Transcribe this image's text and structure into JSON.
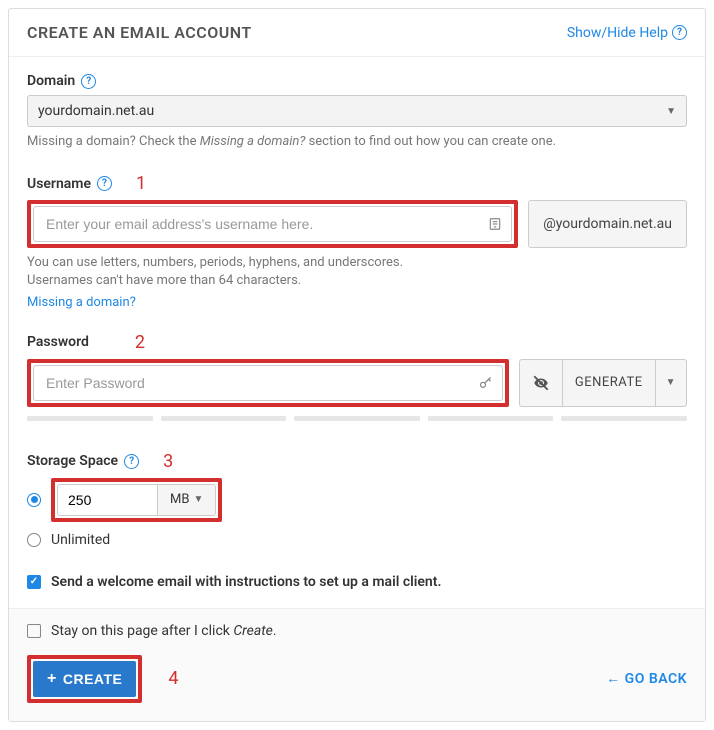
{
  "header": {
    "title": "CREATE AN EMAIL ACCOUNT",
    "help_link": "Show/Hide Help"
  },
  "domain": {
    "label": "Domain",
    "value": "yourdomain.net.au",
    "hint_pre": "Missing a domain? Check the ",
    "hint_em": "Missing a domain?",
    "hint_post": " section to find out how you can create one."
  },
  "username": {
    "label": "Username",
    "placeholder": "Enter your email address's username here.",
    "suffix": "@yourdomain.net.au",
    "hint_line1": "You can use letters, numbers, periods, hyphens, and underscores.",
    "hint_line2": "Usernames can't have more than 64 characters.",
    "missing_link": "Missing a domain?"
  },
  "password": {
    "label": "Password",
    "placeholder": "Enter Password",
    "generate": "GENERATE"
  },
  "storage": {
    "label": "Storage Space",
    "value": "250",
    "unit": "MB",
    "unlimited": "Unlimited"
  },
  "welcome": {
    "label": "Send a welcome email with instructions to set up a mail client."
  },
  "stay": {
    "label_pre": "Stay on this page after I click ",
    "label_em": "Create",
    "label_post": "."
  },
  "actions": {
    "create": "CREATE",
    "back": "GO BACK"
  },
  "annotations": {
    "n1": "1",
    "n2": "2",
    "n3": "3",
    "n4": "4"
  }
}
